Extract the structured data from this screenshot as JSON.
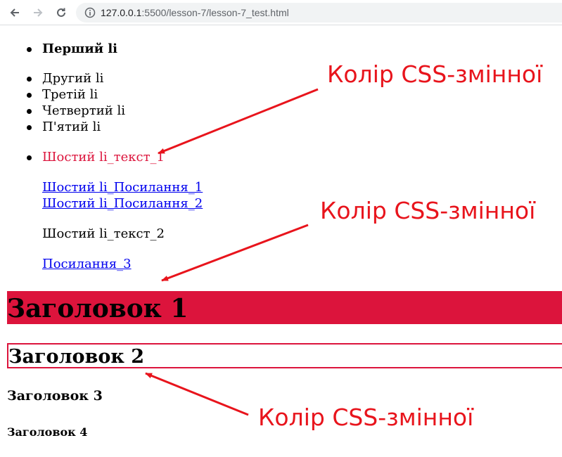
{
  "browser": {
    "url_host": "127.0.0.1",
    "url_path": ":5500/lesson-7/lesson-7_test.html",
    "icons": [
      "back-arrow-icon",
      "forward-arrow-icon",
      "reload-icon",
      "info-icon"
    ]
  },
  "list": {
    "items": [
      "Перший li",
      "Другий li",
      "Третій li",
      "Четвертий li",
      "П'ятий li",
      "Шостий li_текст_1"
    ],
    "links": [
      "Шостий li_Посилання_1",
      "Шостий li_Посилання_2"
    ],
    "text_2": "Шостий li_текст_2",
    "link_3": "Посилання_3"
  },
  "headings": {
    "h1": "Заголовок 1",
    "h2": "Заголовок 2",
    "h3": "Заголовок 3",
    "h4": "Заголовок 4"
  },
  "annotations": [
    "Колір CSS-змінної",
    "Колір CSS-змінної",
    "Колір CSS-змінної"
  ],
  "colors": {
    "css_variable": "#dc143c",
    "annotation": "#e8141c",
    "link": "#0000ee"
  }
}
